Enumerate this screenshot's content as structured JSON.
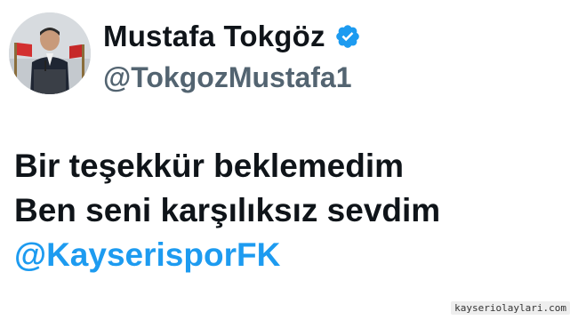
{
  "tweet": {
    "author": {
      "display_name": "Mustafa Tokgöz",
      "handle": "@TokgozMustafa1",
      "verified": true,
      "verified_badge_color": "#1d9bf0"
    },
    "text_lines": [
      "Bir teşekkür beklemedim",
      "Ben seni karşılıksız sevdim"
    ],
    "mention": "@KayserisporFK",
    "mention_color": "#1d9bf0"
  },
  "watermark": {
    "text": "kayseriolaylari.com"
  }
}
